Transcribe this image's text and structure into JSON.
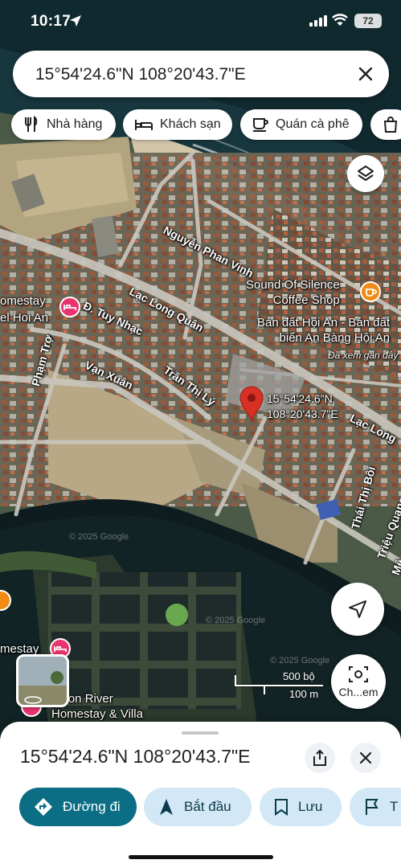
{
  "status_bar": {
    "time": "10:17",
    "battery": "72"
  },
  "search": {
    "query": "15°54'24.6\"N 108°20'43.7\"E"
  },
  "chips": [
    {
      "label": "Nhà hàng",
      "icon": "fork-knife-icon"
    },
    {
      "label": "Khách sạn",
      "icon": "bed-icon"
    },
    {
      "label": "Quán cà phê",
      "icon": "coffee-cup-icon"
    },
    {
      "label": "",
      "icon": "shopping-bag-icon"
    }
  ],
  "map": {
    "streets": {
      "nguyen_phan_vinh": "Nguyễn Phan Vinh",
      "lac_long_quan": "Lạc Long Quân",
      "lac_long_right": "Lạc Long",
      "tuy_nhac": "Đ. Tuy Nhạc",
      "van_xuan": "Vạn Xuân",
      "tran_thi_ly": "Trần Thị Lý",
      "pham_tro": "Phạm Trợ",
      "thai_thi_boi": "Thái Thị Bôi",
      "trieu_quang": "Triệu Quang",
      "me": "Mê"
    },
    "pois": {
      "sound_of_silence": "Sound Of Silence\nCoffee Shop",
      "ban_dat": "Bán đất Hội An - Bán đất\nbiển An Bàng Hội An",
      "recently_viewed": "Đã xem gần đây",
      "homestay_left": "omestay",
      "hotel_left": "el Hoi An",
      "homestay_bottom": "mestay",
      "moon_river": "Moon River\nHomestay & Villa"
    },
    "pin": {
      "coords": "15°54'24.6\"N\n108°20'43.7\"E"
    },
    "watermark_1": "© 2025 Google",
    "watermark_2": "© 2025 Google",
    "watermark_3": "© 2025 Google",
    "scale": {
      "imperial": "500 bộ",
      "metric": "100 m"
    },
    "streetview_label": "Ch...em",
    "colors": {
      "pin": "#d93025",
      "water": "#0e1c1f",
      "accent": "#0b6e85",
      "poi_pink": "#e8336e",
      "poi_orange": "#f28b16"
    }
  },
  "sheet": {
    "title": "15°54'24.6\"N 108°20'43.7\"E",
    "actions": [
      {
        "label": "Đường đi",
        "icon": "directions-icon"
      },
      {
        "label": "Bắt đầu",
        "icon": "navigation-arrow-icon"
      },
      {
        "label": "Lưu",
        "icon": "bookmark-icon"
      },
      {
        "label": "T",
        "icon": "flag-icon"
      }
    ]
  }
}
